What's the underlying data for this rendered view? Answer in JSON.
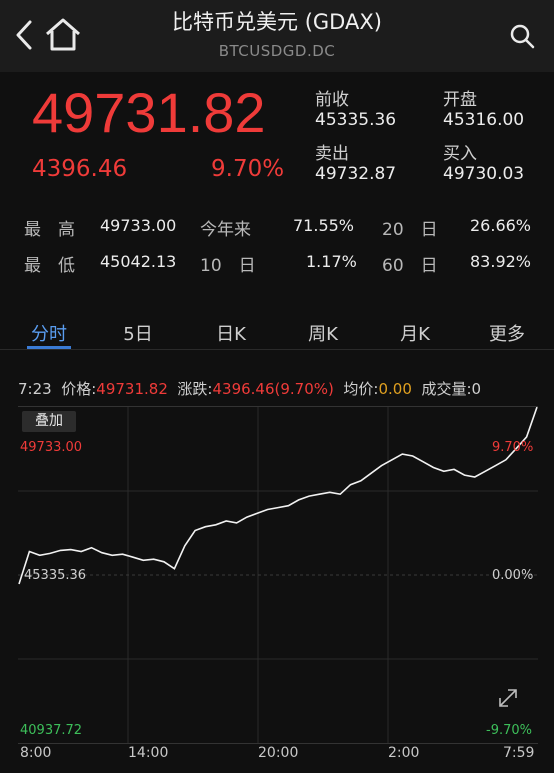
{
  "header": {
    "title": "比特币兑美元 (GDAX)",
    "subtitle": "BTCUSDGD.DC"
  },
  "quote": {
    "price": "49731.82",
    "change": "4396.46",
    "change_pct": "9.70%",
    "prev_close_label": "前收",
    "prev_close": "45335.36",
    "open_label": "开盘",
    "open": "45316.00",
    "ask_label": "卖出",
    "ask": "49732.87",
    "bid_label": "买入",
    "bid": "49730.03"
  },
  "stats": {
    "high_label": "最　高",
    "high": "49733.00",
    "low_label": "最　低",
    "low": "45042.13",
    "ytd_label": "今年来",
    "ytd": "71.55%",
    "d10_label": "10　日",
    "d10": "1.17%",
    "d20_label": "20　日",
    "d20": "26.66%",
    "d60_label": "60　日",
    "d60": "83.92%"
  },
  "tabs": [
    "分时",
    "5日",
    "日K",
    "周K",
    "月K",
    "更多"
  ],
  "info": {
    "time": "7:23",
    "price_label": "价格:",
    "price": "49731.82",
    "change_label": "涨跌:",
    "change": "4396.46(9.70%)",
    "avg_label": "均价:",
    "avg": "0.00",
    "volume_label": "成交量:",
    "volume": "0"
  },
  "chart": {
    "overlay_label": "叠加",
    "ymax_label": "49733.00",
    "ymid_label": "45335.36",
    "ymin_label": "40937.72",
    "pmax_label": "9.70%",
    "pmid_label": "0.00%",
    "pmin_label": "-9.70%",
    "time_labels": [
      "8:00",
      "14:00",
      "20:00",
      "2:00",
      "7:59"
    ]
  },
  "chart_data": {
    "type": "line",
    "ylim": [
      40937.72,
      49733.0
    ],
    "x": [
      0,
      2,
      4,
      6,
      8,
      10,
      12,
      14,
      16,
      18,
      20,
      22,
      24,
      26,
      28,
      30,
      32,
      34,
      36,
      38,
      40,
      42,
      44,
      46,
      48,
      50,
      52,
      54,
      56,
      58,
      60,
      62,
      64,
      66,
      68,
      70,
      72,
      74,
      76,
      78,
      80,
      82,
      84,
      86,
      88,
      90,
      92,
      94,
      96,
      98,
      100
    ],
    "values": [
      45100,
      45950,
      45850,
      45900,
      45980,
      46000,
      45950,
      46050,
      45920,
      45850,
      45880,
      45800,
      45720,
      45750,
      45680,
      45500,
      46100,
      46500,
      46600,
      46650,
      46750,
      46700,
      46850,
      46950,
      47050,
      47100,
      47150,
      47300,
      47400,
      47450,
      47500,
      47450,
      47700,
      47800,
      48000,
      48200,
      48350,
      48500,
      48450,
      48300,
      48150,
      48050,
      48100,
      47950,
      47900,
      48050,
      48200,
      48350,
      48650,
      48950,
      49731
    ]
  },
  "colors": {
    "accent_red": "#ef3b39",
    "accent_green": "#3dbf5a",
    "tab_active": "#3a7bd5",
    "avg_gold": "#e0a020"
  },
  "icons": {
    "back": "chevron-left-icon",
    "home": "home-icon",
    "search": "search-icon",
    "expand": "expand-icon"
  }
}
